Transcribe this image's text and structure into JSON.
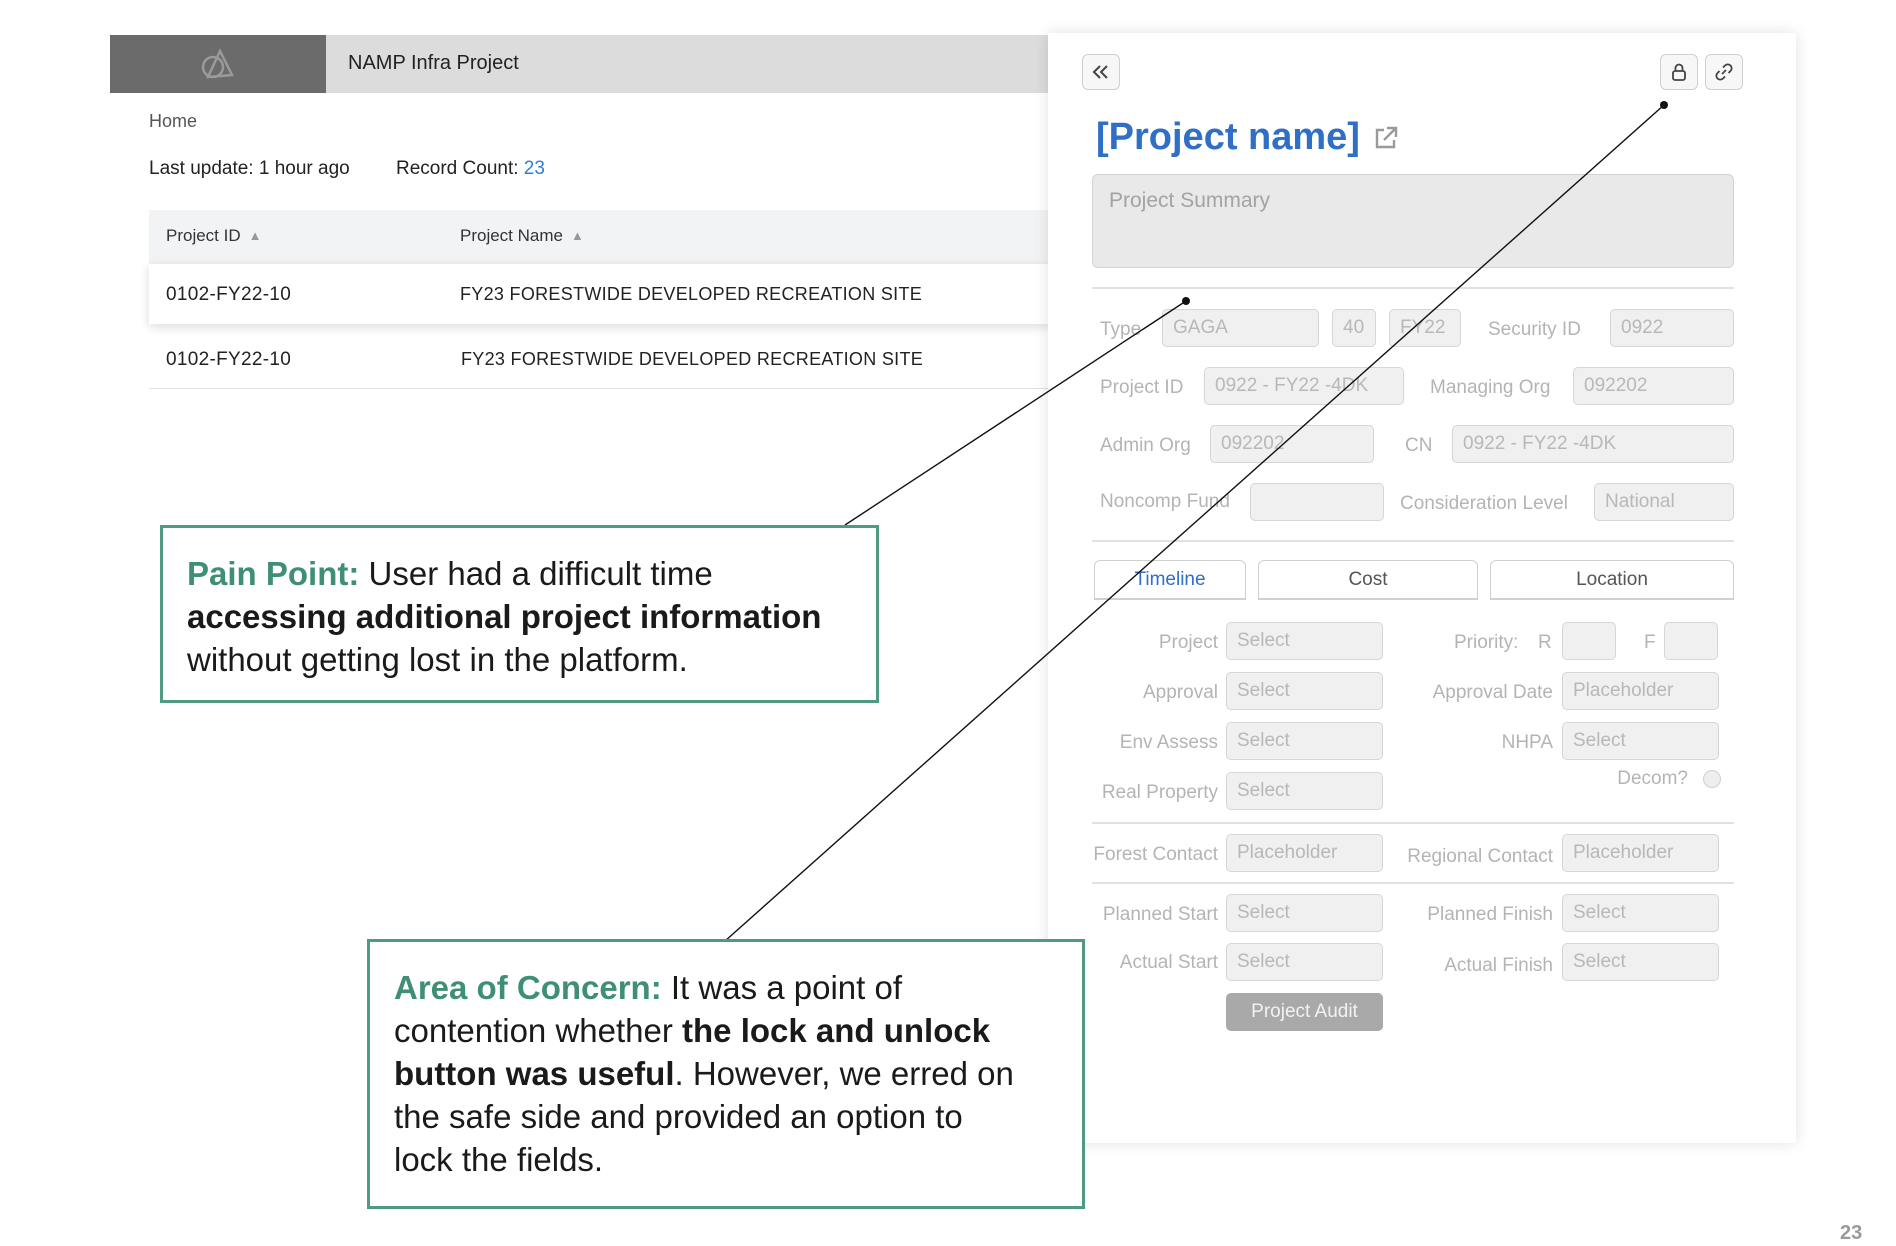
{
  "app": {
    "title": "NAMP Infra Project",
    "breadcrumb": "Home",
    "last_update": "Last update: 1 hour ago",
    "record_count_label": "Record Count:",
    "record_count": "23"
  },
  "table": {
    "columns": [
      "Project ID",
      "Project Name"
    ],
    "rows": [
      [
        "0102-FY22-10",
        "FY23 FORESTWIDE DEVELOPED RECREATION SITE"
      ],
      [
        "0102-FY22-10",
        "FY23 FORESTWIDE DEVELOPED RECREATION SITE"
      ]
    ]
  },
  "panel": {
    "project_name": "[Project name]",
    "summary_placeholder": "Project Summary",
    "fields": {
      "type_label": "Type",
      "type_value": "GAGA",
      "num_value": "40",
      "fy_value": "FY22",
      "security_label": "Security ID",
      "security_value": "0922",
      "project_id_label": "Project ID",
      "project_id_value": "0922 - FY22 -4DK",
      "managing_org_label": "Managing Org",
      "managing_org_value": "092202",
      "admin_org_label": "Admin Org",
      "admin_org_value": "092202",
      "cn_label": "CN",
      "cn_value": "0922 - FY22 -4DK",
      "noncomp_label": "Noncomp Fund",
      "noncomp_value": "",
      "consideration_label": "Consideration Level",
      "consideration_value": "National"
    },
    "tabs": [
      "Timeline",
      "Cost",
      "Location"
    ],
    "timeline": {
      "project_label": "Project",
      "approval_label": "Approval",
      "env_label": "Env Assess",
      "real_label": "Real Property",
      "select": "Select",
      "priority_label": "Priority:",
      "r_label": "R",
      "f_label": "F",
      "approval_date_label": "Approval Date",
      "placeholder": "Placeholder",
      "nhpa_label": "NHPA",
      "decom_label": "Decom?",
      "forest_contact_label": "Forest Contact",
      "regional_contact_label": "Regional Contact",
      "planned_start_label": "Planned Start",
      "planned_finish_label": "Planned Finish",
      "actual_start_label": "Actual Start",
      "actual_finish_label": "Actual Finish",
      "audit_button": "Project Audit"
    }
  },
  "callouts": {
    "pain_heading": "Pain Point:",
    "pain_text1": " User had a difficult time",
    "pain_bold": "accessing additional project information",
    "pain_text2": "without getting lost in the platform.",
    "concern_heading": "Area of Concern:",
    "concern_text1": " It was a point of",
    "concern_text2": "contention whether ",
    "concern_bold1": "the lock and unlock",
    "concern_bold2": "button was useful",
    "concern_text3": ". However, we erred on",
    "concern_text4": "the safe side and provided an option to",
    "concern_text5": "lock the fields."
  },
  "page_number": "23",
  "colors": {
    "accent_green": "#3f8f73",
    "link_blue": "#2f6fc5"
  }
}
